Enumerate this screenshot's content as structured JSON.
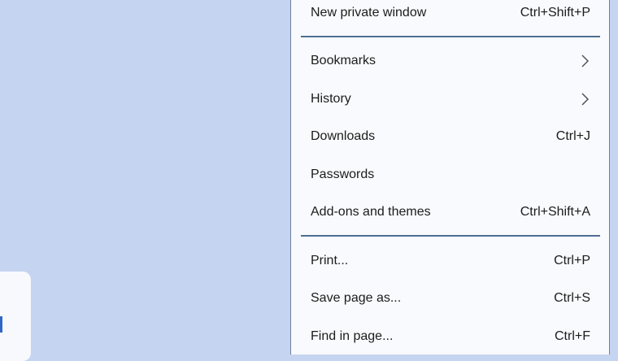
{
  "menu": {
    "items": [
      {
        "label": "New private window",
        "shortcut": "Ctrl+Shift+P"
      },
      {
        "label": "Bookmarks",
        "submenu": true
      },
      {
        "label": "History",
        "submenu": true
      },
      {
        "label": "Downloads",
        "shortcut": "Ctrl+J"
      },
      {
        "label": "Passwords",
        "shortcut": ""
      },
      {
        "label": "Add-ons and themes",
        "shortcut": "Ctrl+Shift+A"
      },
      {
        "label": "Print...",
        "shortcut": "Ctrl+P"
      },
      {
        "label": "Save page as...",
        "shortcut": "Ctrl+S"
      },
      {
        "label": "Find in page...",
        "shortcut": "Ctrl+F"
      }
    ],
    "submenu_icon": "chevron-right-icon"
  },
  "colors": {
    "desktop_background": "#c5d4f0",
    "menu_background": "#f9fafd",
    "separator": "#506e94",
    "text": "#1c1c1c"
  }
}
